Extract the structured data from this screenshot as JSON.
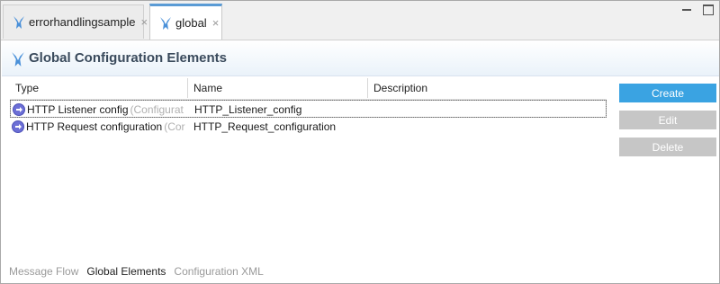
{
  "tabs": [
    {
      "label": "errorhandlingsample",
      "close": "×",
      "active": false
    },
    {
      "label": "global",
      "close": "×",
      "active": true
    }
  ],
  "header": {
    "title": "Global Configuration Elements"
  },
  "table": {
    "columns": [
      "Type",
      "Name",
      "Description"
    ],
    "rows": [
      {
        "type": "HTTP Listener config",
        "type_hint": "(Configurat",
        "name": "HTTP_Listener_config",
        "description": "",
        "icon": "connector-icon"
      },
      {
        "type": "HTTP Request configuration",
        "type_hint": "(Cor",
        "name": "HTTP_Request_configuration",
        "description": "",
        "icon": "connector-icon"
      }
    ]
  },
  "buttons": {
    "create": "Create",
    "edit": "Edit",
    "delete": "Delete"
  },
  "bottom_tabs": [
    "Message Flow",
    "Global Elements",
    "Configuration XML"
  ],
  "colors": {
    "accent": "#3aa3e2",
    "disabled": "#c6c6c6",
    "header_text": "#3a4a5c"
  }
}
